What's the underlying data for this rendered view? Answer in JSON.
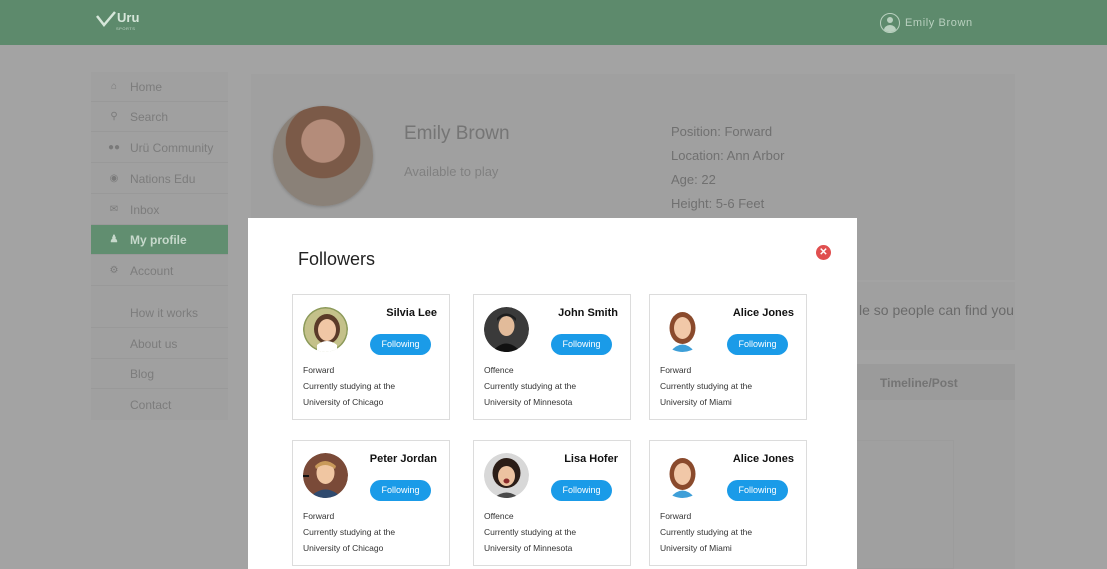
{
  "header": {
    "logo_text": "Uru",
    "logo_subtext": "SPORTS",
    "user_name": "Emily Brown"
  },
  "sidebar": {
    "items": [
      {
        "label": "Home",
        "icon": "home-icon"
      },
      {
        "label": "Search",
        "icon": "search-icon"
      },
      {
        "label": "Urü Community",
        "icon": "community-icon"
      },
      {
        "label": "Nations Edu",
        "icon": "globe-icon"
      },
      {
        "label": "Inbox",
        "icon": "mail-icon"
      },
      {
        "label": "My profile",
        "icon": "user-icon",
        "active": true
      },
      {
        "label": "Account",
        "icon": "gear-icon"
      },
      {
        "label": "How it works"
      },
      {
        "label": "About us"
      },
      {
        "label": "Blog"
      },
      {
        "label": "Contact"
      }
    ]
  },
  "profile": {
    "name": "Emily Brown",
    "status": "Available to play",
    "position": "Position: Forward",
    "location": "Location: Ann Arbor",
    "age": "Age: 22",
    "height": "Height: 5-6 Feet",
    "hint_text": "le so people can find you",
    "timeline_tab": "Timeline/Post"
  },
  "modal": {
    "title": "Followers",
    "close_icon": "close-icon",
    "followers": [
      {
        "name": "Silvia Lee",
        "button": "Following",
        "position": "Forward",
        "line1": "Currently studying at the",
        "line2": "University of Chicago"
      },
      {
        "name": "John Smith",
        "button": "Following",
        "position": "Offence",
        "line1": "Currently studying at the",
        "line2": "University of Minnesota"
      },
      {
        "name": "Alice Jones",
        "button": "Following",
        "position": "Forward",
        "line1": "Currently studying at the",
        "line2": "University of Miami"
      },
      {
        "name": "Peter Jordan",
        "button": "Following",
        "position": "Forward",
        "line1": "Currently studying at the",
        "line2": "University of Chicago"
      },
      {
        "name": "Lisa Hofer",
        "button": "Following",
        "position": "Offence",
        "line1": "Currently studying at the",
        "line2": "University of Minnesota"
      },
      {
        "name": "Alice Jones",
        "button": "Following",
        "position": "Forward",
        "line1": "Currently studying at the",
        "line2": "University of Miami"
      }
    ]
  },
  "colors": {
    "header_bg": "#5d8a6c",
    "overlay_bg": "#a3a3a3",
    "button_blue": "#1a9be8",
    "close_red": "#e04f4f"
  }
}
